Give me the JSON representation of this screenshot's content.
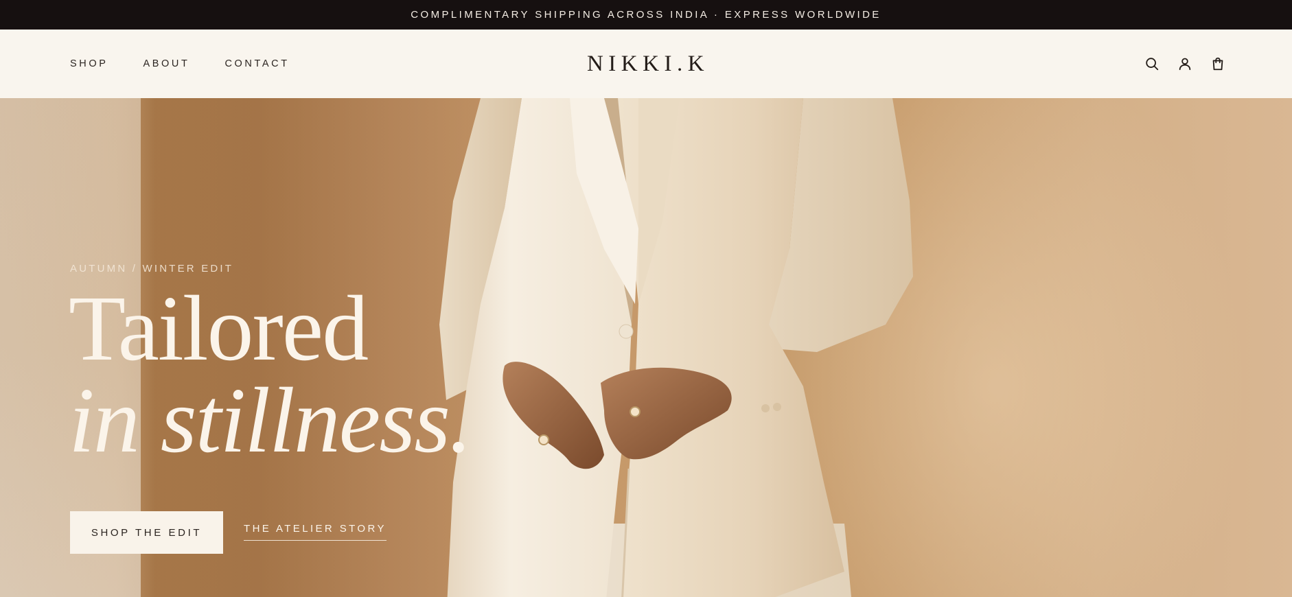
{
  "announcement": {
    "text": "COMPLIMENTARY SHIPPING ACROSS INDIA · EXPRESS WORLDWIDE"
  },
  "header": {
    "logo": "NIKKI.K",
    "nav": [
      {
        "label": "SHOP"
      },
      {
        "label": "ABOUT"
      },
      {
        "label": "CONTACT"
      }
    ],
    "icons": [
      "search-icon",
      "account-icon",
      "shopping-bag-icon"
    ]
  },
  "hero": {
    "eyebrow": "AUTUMN / WINTER EDIT",
    "headline_line1": "Tailored",
    "headline_line2": "in stillness.",
    "primary_cta": "SHOP THE EDIT",
    "secondary_cta": "THE ATELIER STORY",
    "image": "model-in-cream-tailored-suit"
  },
  "colors": {
    "announcement_bg": "#161010",
    "header_bg": "#f9f5ee",
    "hero_tone": "#b6865a",
    "suit_cream": "#f2e8d8",
    "text_dark": "#2b2420",
    "text_light": "#fbf4ea"
  }
}
